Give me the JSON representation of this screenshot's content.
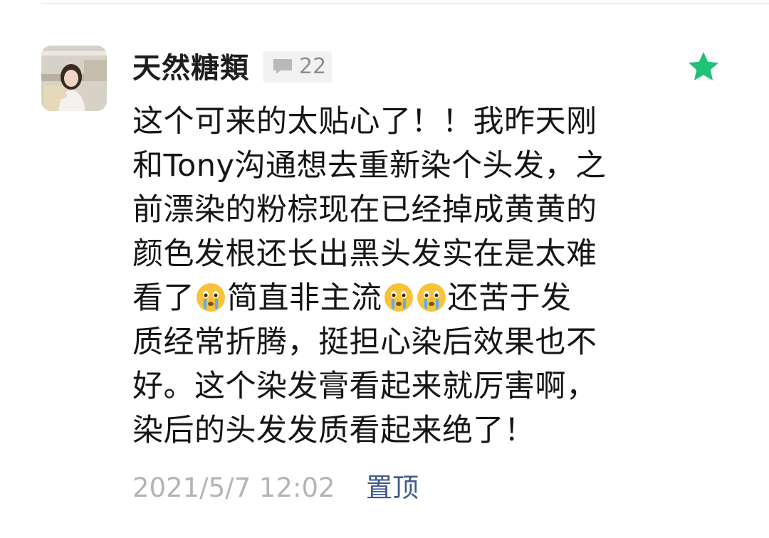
{
  "comment": {
    "author": "天然糖類",
    "reply_count": "22",
    "avatar_icon": "user-photo-avatar",
    "reply_icon": "comment-bubble-icon",
    "favorite_icon": "star-icon",
    "favorite_color": "#1fc276",
    "content_lines": [
      {
        "segments": [
          "这个可来的太贴心了！！我昨天刚"
        ]
      },
      {
        "segments": [
          "和Tony沟通想去重新染个头发，之"
        ]
      },
      {
        "segments": [
          "前漂染的粉棕现在已经掉成黄黄的"
        ]
      },
      {
        "segments": [
          "颜色发根还长出黑头发实在是太难"
        ]
      },
      {
        "segments": [
          "看了",
          "简直非主流",
          "",
          "还苦于发"
        ]
      },
      {
        "segments": [
          "质经常折腾，挺担心染后效果也不"
        ]
      },
      {
        "segments": [
          "好。这个染发膏看起来就厉害啊，"
        ]
      },
      {
        "segments": [
          "染后的头发发质看起来绝了！"
        ]
      }
    ],
    "emoji_icon": "crying-face-emoji",
    "timestamp": "2021/5/7 12:02",
    "pin_label": "置顶",
    "link_color": "#3d5a8a"
  }
}
